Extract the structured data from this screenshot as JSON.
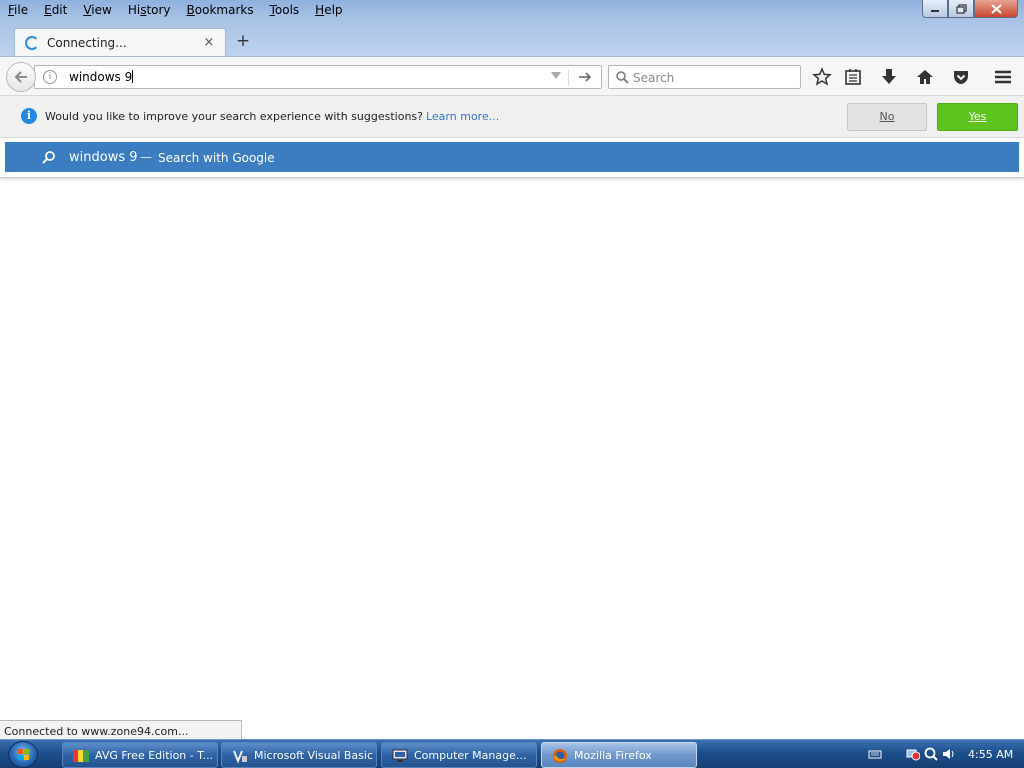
{
  "menu": {
    "items": [
      {
        "key": "F",
        "rest": "ile"
      },
      {
        "key": "E",
        "rest": "dit"
      },
      {
        "key": "V",
        "rest": "iew"
      },
      {
        "pre": "Hi",
        "key": "s",
        "rest": "tory"
      },
      {
        "key": "B",
        "rest": "ookmarks"
      },
      {
        "key": "T",
        "rest": "ools"
      },
      {
        "key": "H",
        "rest": "elp"
      }
    ]
  },
  "window_controls": {
    "minimize": "minimize-icon",
    "restore": "restore-icon",
    "close": "close-icon"
  },
  "tab": {
    "title": "Connecting...",
    "close_glyph": "×"
  },
  "new_tab_glyph": "+",
  "urlbar": {
    "value": "windows 9"
  },
  "searchbar": {
    "placeholder": "Search"
  },
  "toolbar_icons": [
    "bookmark-star-icon",
    "bookmarks-menu-icon",
    "downloads-icon",
    "home-icon",
    "pocket-icon",
    "hamburger-menu-icon"
  ],
  "notification": {
    "text": "Would you like to improve your search experience with suggestions?",
    "link": "Learn more...",
    "no_label": "No",
    "yes_label": "Yes"
  },
  "autocomplete": {
    "query": "windows 9",
    "separator": "—",
    "action": "Search with Google"
  },
  "status": {
    "text": "Connected to www.zone94.com..."
  },
  "taskbar": {
    "buttons": [
      {
        "label": "AVG Free Edition - T...",
        "active": false
      },
      {
        "label": "Microsoft Visual Basic",
        "active": false
      },
      {
        "label": "Computer Manage...",
        "active": false
      },
      {
        "label": "Mozilla Firefox",
        "active": true
      }
    ],
    "clock": "4:55 AM"
  },
  "colors": {
    "accent_blue": "#3c7cc0",
    "yes_green": "#5ec31c",
    "link_blue": "#3277c4",
    "titlebar_blue": "#a9c3e6"
  }
}
